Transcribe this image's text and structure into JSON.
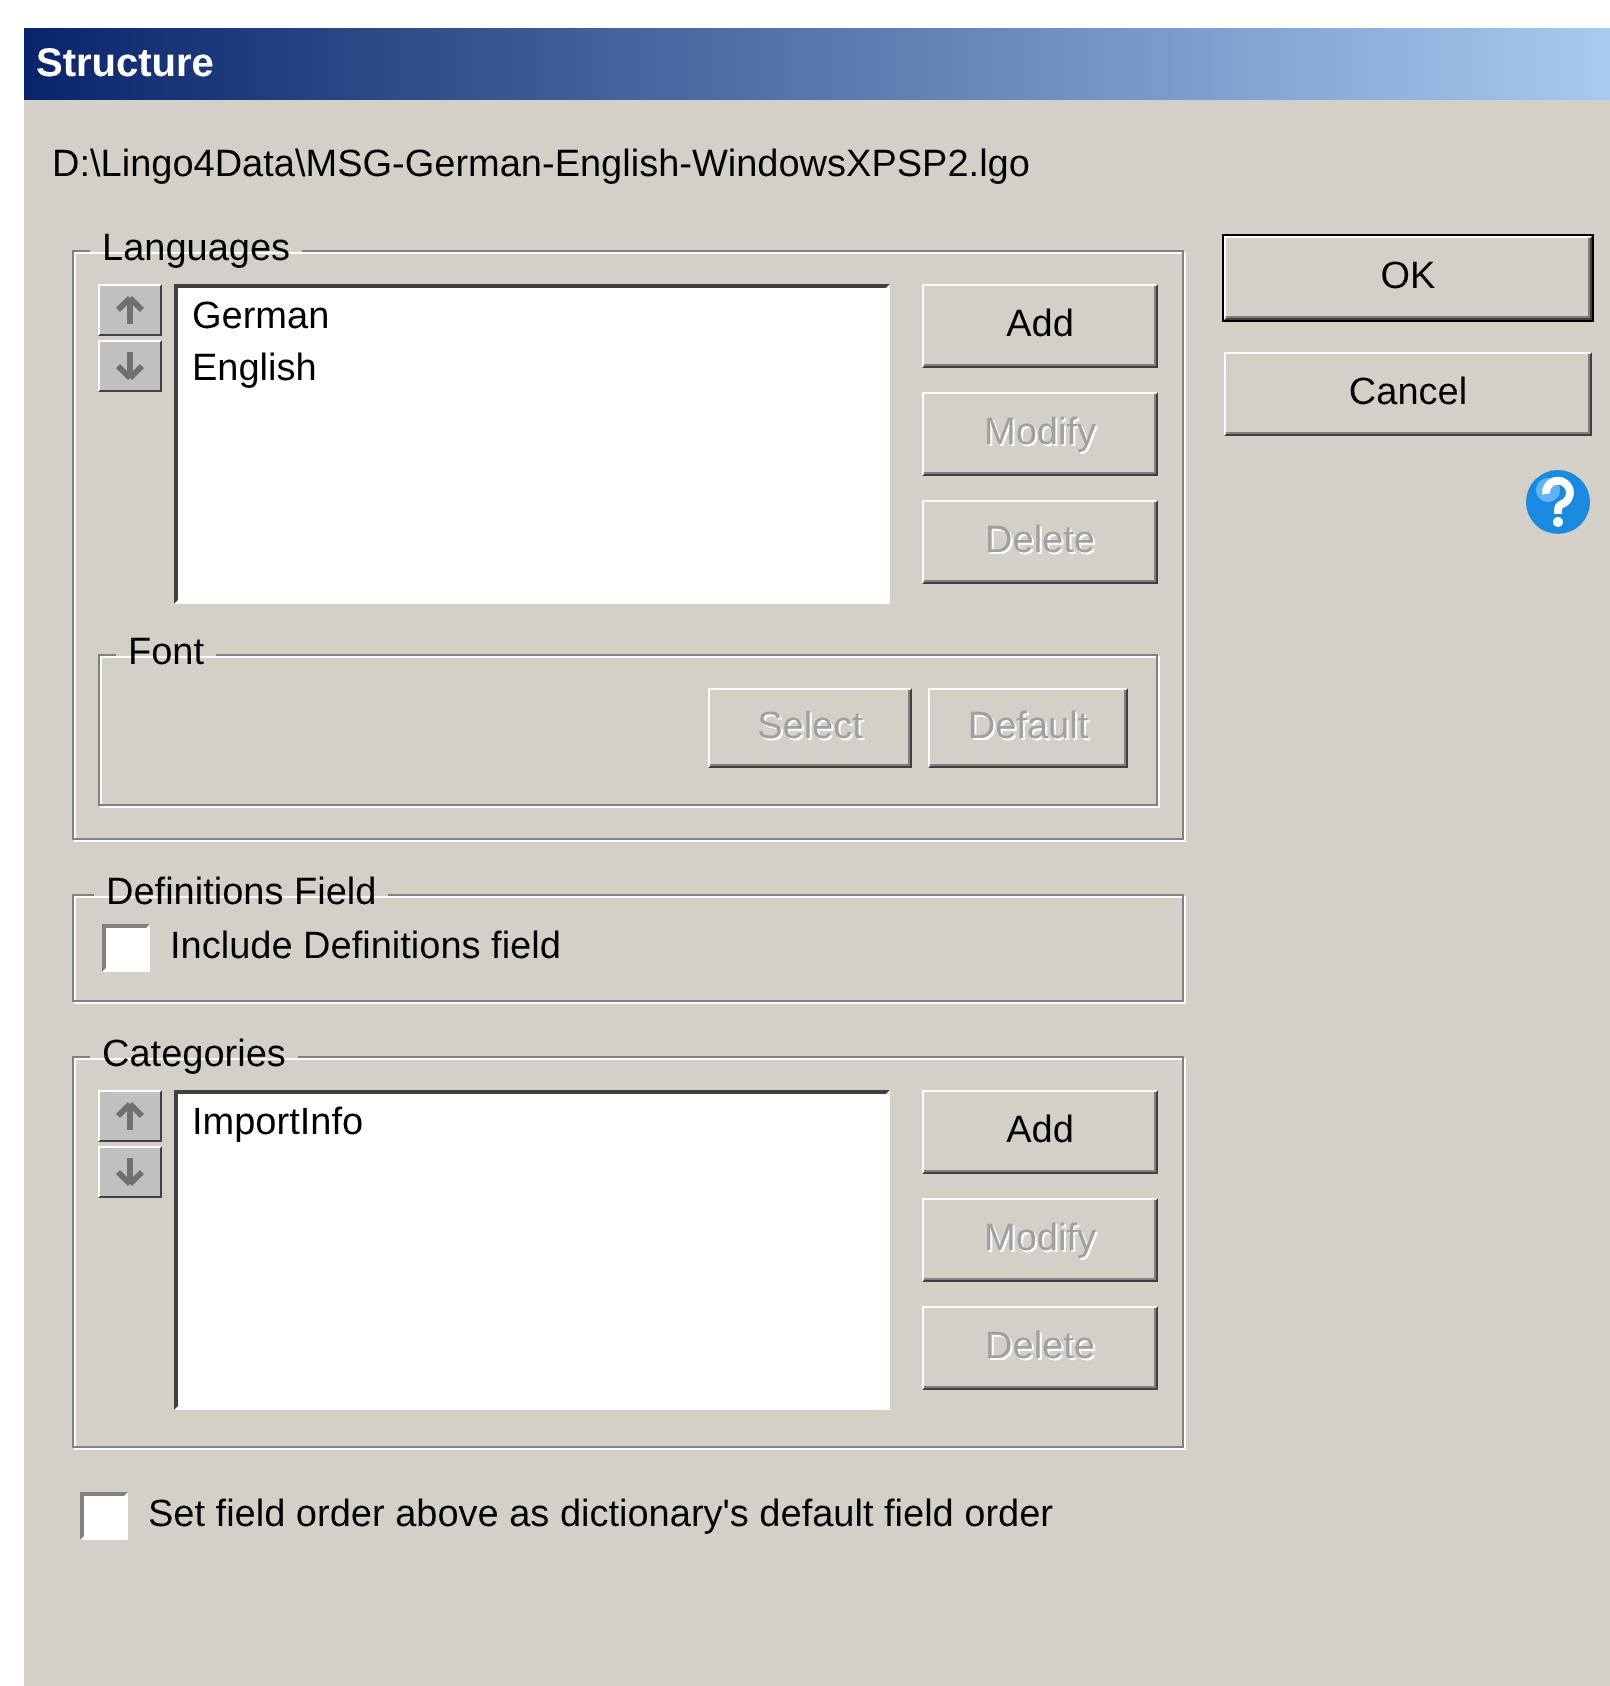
{
  "window": {
    "title": "Structure"
  },
  "path": "D:\\Lingo4Data\\MSG-German-English-WindowsXPSP2.lgo",
  "languages": {
    "label": "Languages",
    "items": [
      {
        "text": "German",
        "selected": false
      },
      {
        "text": "English",
        "selected": false
      }
    ],
    "buttons": [
      {
        "label": "Add",
        "disabled": false
      },
      {
        "label": "Modify",
        "disabled": true
      },
      {
        "label": "Delete",
        "disabled": true
      }
    ],
    "font": {
      "label": "Font",
      "buttons": [
        {
          "label": "Select",
          "disabled": true
        },
        {
          "label": "Default",
          "disabled": true
        }
      ]
    }
  },
  "definitions": {
    "label": "Definitions Field",
    "checkbox": {
      "label": "Include Definitions field",
      "checked": false
    }
  },
  "categories": {
    "label": "Categories",
    "items": [
      {
        "text": "ImportInfo",
        "selected": false
      }
    ],
    "buttons": [
      {
        "label": "Add",
        "disabled": false
      },
      {
        "label": "Modify",
        "disabled": true
      },
      {
        "label": "Delete",
        "disabled": true
      }
    ]
  },
  "default_order": {
    "label": "Set field order above as dictionary's default field order",
    "checked": false
  },
  "buttons": [
    {
      "label": "OK",
      "default": true
    },
    {
      "label": "Cancel",
      "default": false
    }
  ]
}
